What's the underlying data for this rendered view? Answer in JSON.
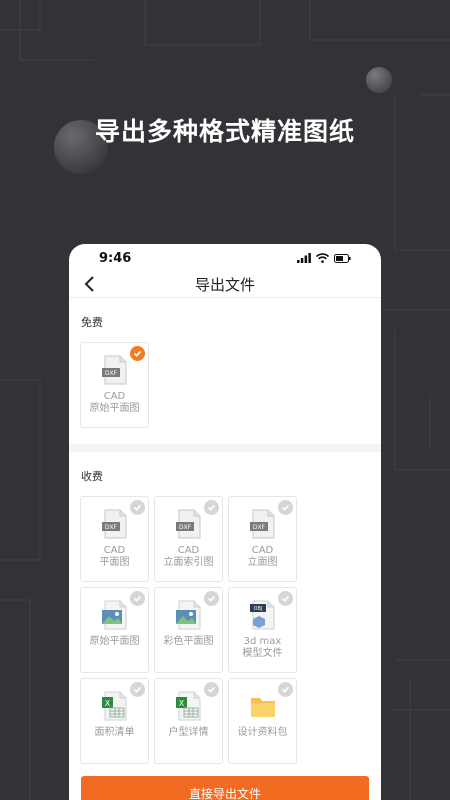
{
  "headline": "导出多种格式精准图纸",
  "status": {
    "time": "9:46"
  },
  "nav": {
    "title": "导出文件"
  },
  "free_section": {
    "label": "免费",
    "items": [
      {
        "label": "CAD\n原始平面图",
        "icon": "dxf-file-icon",
        "checked": true
      }
    ]
  },
  "paid_section": {
    "label": "收费",
    "items": [
      {
        "label": "CAD\n平面图",
        "icon": "dxf-file-icon",
        "checked": false
      },
      {
        "label": "CAD\n立面索引图",
        "icon": "dxf-file-icon",
        "checked": false
      },
      {
        "label": "CAD\n立面图",
        "icon": "dxf-file-icon",
        "checked": false
      },
      {
        "label": "原始平面图",
        "icon": "image-file-icon",
        "checked": false
      },
      {
        "label": "彩色平面图",
        "icon": "image-file-icon",
        "checked": false
      },
      {
        "label": "3d max\n模型文件",
        "icon": "obj-file-icon",
        "checked": false
      },
      {
        "label": "面积清单",
        "icon": "excel-file-icon",
        "checked": false
      },
      {
        "label": "户型详情",
        "icon": "excel-file-icon",
        "checked": false
      },
      {
        "label": "设计资料包",
        "icon": "folder-icon",
        "checked": false
      }
    ]
  },
  "button": {
    "label": "直接导出文件"
  },
  "colors": {
    "accent": "#f36b21",
    "background": "#333337"
  }
}
